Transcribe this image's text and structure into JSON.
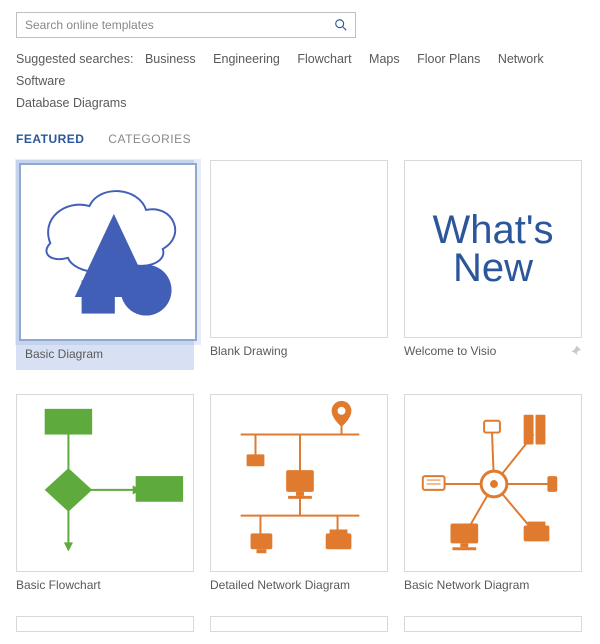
{
  "search": {
    "placeholder": "Search online templates"
  },
  "suggested": {
    "label": "Suggested searches:",
    "links": [
      "Business",
      "Engineering",
      "Flowchart",
      "Maps",
      "Floor Plans",
      "Network",
      "Software",
      "Database Diagrams"
    ]
  },
  "tabs": {
    "featured": "FEATURED",
    "categories": "CATEGORIES"
  },
  "templates": {
    "t0": {
      "name": "Basic Diagram"
    },
    "t1": {
      "name": "Blank Drawing"
    },
    "t2": {
      "name": "Welcome to Visio",
      "whatsnew_line1": "What's",
      "whatsnew_line2": "New"
    },
    "t3": {
      "name": "Basic Flowchart"
    },
    "t4": {
      "name": "Detailed Network Diagram"
    },
    "t5": {
      "name": "Basic Network Diagram"
    }
  },
  "colors": {
    "accent": "#2b579a",
    "basicshapes": "#415fb6",
    "flowgreen": "#5faa3d",
    "networkorange": "#e07a2f"
  }
}
